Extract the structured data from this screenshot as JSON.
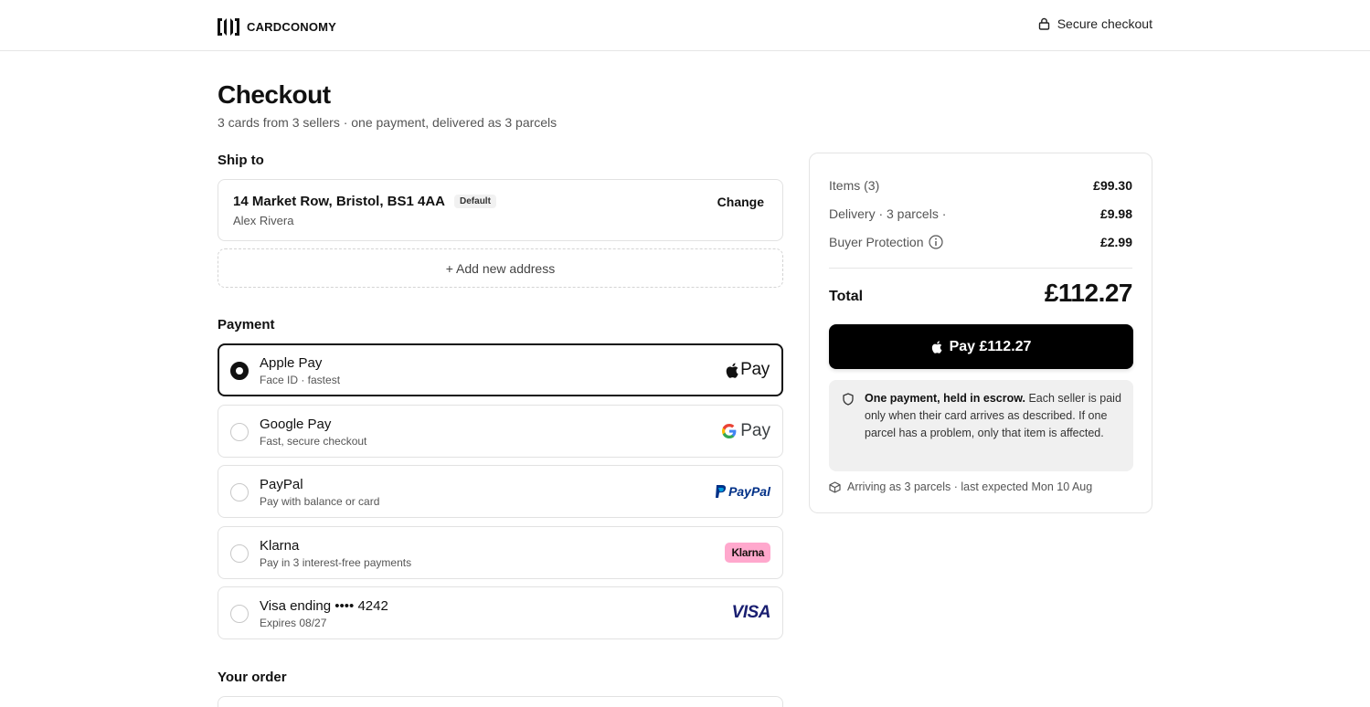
{
  "header": {
    "brand_name": "CARDCONOMY",
    "brand_icon": "brand-logo",
    "secure_label": "Secure checkout",
    "secure_icon": "lock-icon"
  },
  "page": {
    "title": "Checkout",
    "subtitle": "3 cards from 3 sellers · one payment, delivered as 3 parcels"
  },
  "ship_to": {
    "label": "Ship to",
    "address": "14 Market Row, Bristol, BS1 4AA",
    "badge": "Default",
    "name": "Alex Rivera",
    "change_label": "Change",
    "add_label": "+ Add new address"
  },
  "payment": {
    "label": "Payment",
    "options": [
      {
        "title": "Apple Pay",
        "subtitle": "Face ID · fastest",
        "logo_text": "Pay",
        "selected": true
      },
      {
        "title": "Google Pay",
        "subtitle": "Fast, secure checkout",
        "logo_text": "Pay",
        "selected": false
      },
      {
        "title": "PayPal",
        "subtitle": "Pay with balance or card",
        "logo_text": "PayPal",
        "selected": false
      },
      {
        "title": "Klarna",
        "subtitle": "Pay in 3 interest-free payments",
        "logo_text": "Klarna",
        "selected": false
      },
      {
        "title": "Visa ending •••• 4242",
        "subtitle": "Expires 08/27",
        "logo_text": "VISA",
        "selected": false
      }
    ]
  },
  "order": {
    "label": "Your order"
  },
  "summary": {
    "items_label": "Items (3)",
    "items_value": "£99.30",
    "delivery_label": "Delivery · 3 parcels ·",
    "delivery_value": "£9.98",
    "protection_label": "Buyer Protection",
    "protection_value": "£2.99",
    "total_label": "Total",
    "total_value": "£112.27",
    "pay_button": "Pay £112.27",
    "escrow_bold": "One payment, held in escrow.",
    "escrow_rest": " Each seller is paid only when their card arrives as described. If one parcel has a problem, only that item is affected.",
    "arrival": "Arriving as 3 parcels · last expected Mon 10 Aug"
  },
  "colors": {
    "text": "#111111",
    "muted": "#555555",
    "border": "#e2e2e2",
    "button": "#000000",
    "escrow_bg": "#f0f0f0",
    "paypal_dark": "#003087",
    "paypal_light": "#009cde",
    "klarna_pink": "#ffa8cd",
    "visa_blue": "#1a1f71",
    "google_blue": "#4285f4",
    "google_red": "#ea4335",
    "google_yellow": "#fbbc05",
    "google_green": "#34a853"
  }
}
